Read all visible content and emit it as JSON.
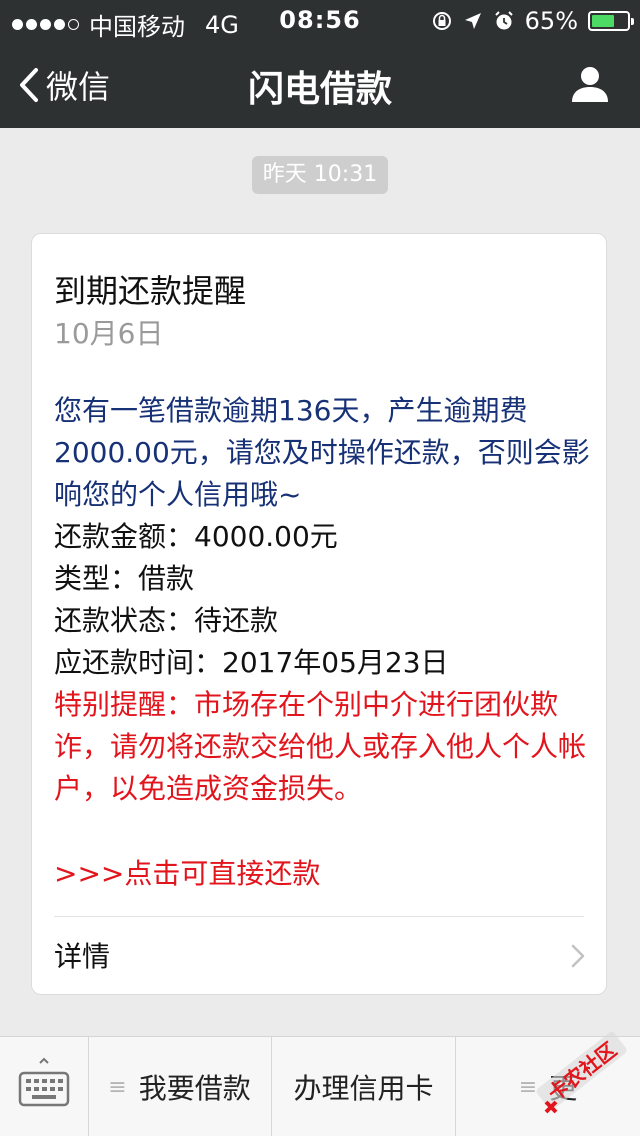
{
  "status_bar": {
    "carrier": "中国移动",
    "network": "4G",
    "time": "08:56",
    "battery_percent": "65%",
    "battery_level": 0.65,
    "signal_bars_filled": 4,
    "signal_bars_total": 5
  },
  "nav": {
    "back_label": "微信",
    "title": "闪电借款",
    "profile_icon": "person-icon"
  },
  "timestamp": "昨天 10:31",
  "card": {
    "title": "到期还款提醒",
    "date": "10月6日",
    "intro": "您有一笔借款逾期136天，产生逾期费2000.00元，请您及时操作还款，否则会影响您的个人信用哦~",
    "amount_line": "还款金额：4000.00元",
    "type_line": "类型：借款",
    "status_line": "还款状态：待还款",
    "due_line": "应还款时间：2017年05月23日",
    "warning": "特别提醒：市场存在个别中介进行团伙欺诈，请勿将还款交给他人或存入他人个人帐户，以免造成资金损失。",
    "pay_link": ">>>点击可直接还款",
    "details_label": "详情"
  },
  "bottom_menu": {
    "keyboard_icon": "keyboard-icon",
    "items": [
      {
        "label": "我要借款",
        "icon": "≡"
      },
      {
        "label": "办理信用卡",
        "icon": ""
      },
      {
        "label": "更",
        "icon": "≡"
      }
    ]
  },
  "watermark_text": "卡农社区",
  "colors": {
    "nav_bg": "#2e3132",
    "intro_blue": "#173177",
    "warning_red": "#e2141c",
    "battery_green": "#4cd964"
  }
}
